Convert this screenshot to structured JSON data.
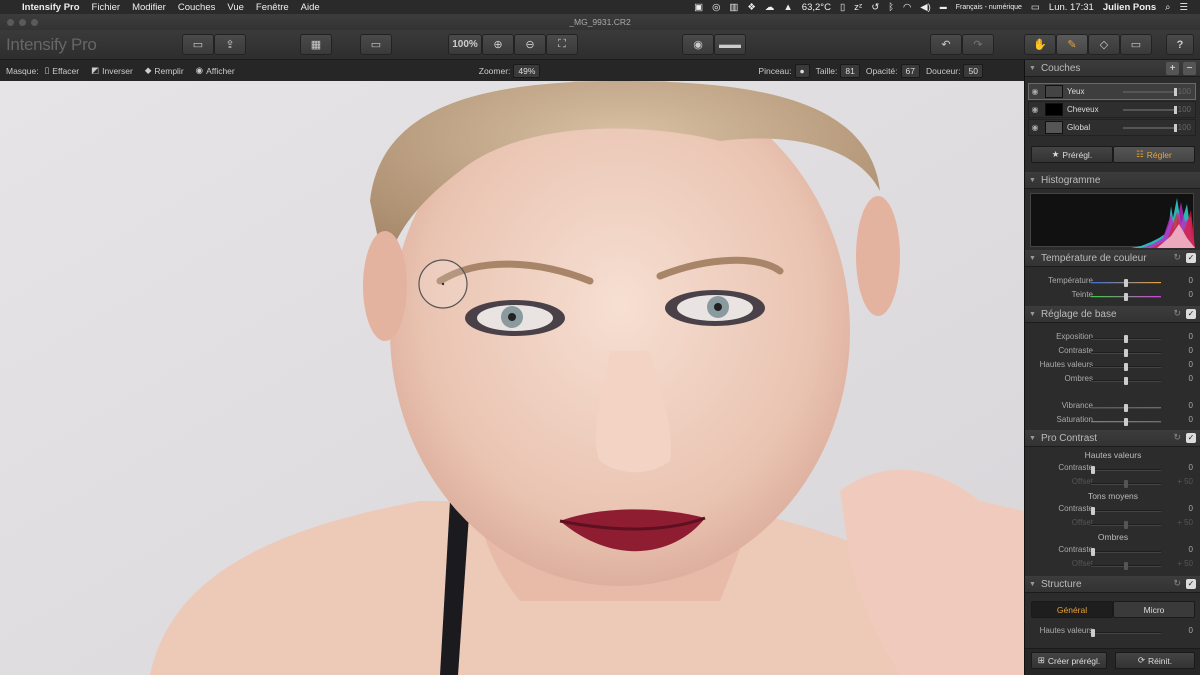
{
  "menubar": {
    "app": "Intensify Pro",
    "items": [
      "Fichier",
      "Modifier",
      "Couches",
      "Vue",
      "Fenêtre",
      "Aide"
    ],
    "temperature": "63,2°C",
    "input_source": "Français - numérique",
    "clock": "Lun. 17:31",
    "user": "Julien Pons"
  },
  "window": {
    "title": "_MG_9931.CR2"
  },
  "toolbar": {
    "logo": "Intensify Pro",
    "zoom_label": "100%"
  },
  "optbar": {
    "masque_label": "Masque:",
    "effacer": "Effacer",
    "inverser": "Inverser",
    "remplir": "Remplir",
    "afficher": "Afficher",
    "zoomer_label": "Zoomer:",
    "zoomer_value": "49%",
    "pinceau_label": "Pinceau:",
    "taille_label": "Taille:",
    "taille_value": "81",
    "opacite_label": "Opacité:",
    "opacite_value": "67",
    "douceur_label": "Douceur:",
    "douceur_value": "50"
  },
  "panel": {
    "couches": {
      "title": "Couches",
      "layers": [
        {
          "name": "Yeux",
          "value": "100"
        },
        {
          "name": "Cheveux",
          "value": "100"
        },
        {
          "name": "Global",
          "value": "100"
        }
      ]
    },
    "tabs": {
      "presets": "Prérégl.",
      "adjust": "Régler"
    },
    "histogramme": {
      "title": "Histogramme"
    },
    "temperature": {
      "title": "Température de couleur",
      "rows": [
        {
          "label": "Température",
          "value": "0",
          "pos": 0.5
        },
        {
          "label": "Teinte",
          "value": "0",
          "pos": 0.5
        }
      ]
    },
    "base": {
      "title": "Réglage de base",
      "rows": [
        {
          "label": "Exposition",
          "value": "0",
          "pos": 0.5
        },
        {
          "label": "Contraste",
          "value": "0",
          "pos": 0.5
        },
        {
          "label": "Hautes valeurs",
          "value": "0",
          "pos": 0.5
        },
        {
          "label": "Ombres",
          "value": "0",
          "pos": 0.5
        },
        {
          "label": "Vibrance",
          "value": "0",
          "pos": 0.5
        },
        {
          "label": "Saturation",
          "value": "0",
          "pos": 0.5
        }
      ]
    },
    "procontrast": {
      "title": "Pro Contrast",
      "groups": [
        {
          "heading": "Hautes valeurs",
          "contraste": "0",
          "offset": "+ 50"
        },
        {
          "heading": "Tons moyens",
          "contraste": "0",
          "offset": "+ 50"
        },
        {
          "heading": "Ombres",
          "contraste": "0",
          "offset": "+ 50"
        }
      ],
      "contraste_label": "Contraste",
      "offset_label": "Offset"
    },
    "structure": {
      "title": "Structure",
      "tab_general": "Général",
      "tab_micro": "Micro",
      "row_label": "Hautes valeurs",
      "row_value": "0"
    },
    "footer": {
      "create": "Créer prérégl.",
      "reset": "Réinit."
    }
  },
  "colors": {
    "accent": "#e8a33a",
    "panel_bg": "#2c2c2c"
  }
}
